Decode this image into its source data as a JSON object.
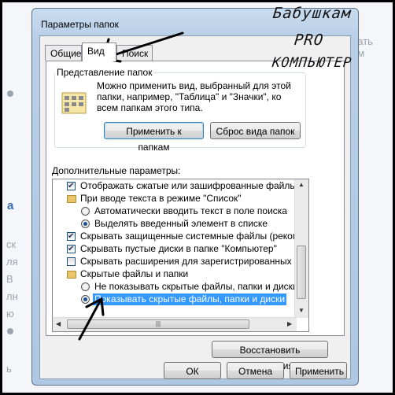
{
  "background": {
    "fragments": [
      "Бабушкам",
      "ть",
      "здать изм",
      "а",
      "ск",
      "ля",
      "В",
      "лн",
      "ю",
      "ь"
    ]
  },
  "window": {
    "title": "Параметры папок",
    "tabs": [
      "Общие",
      "Вид",
      "Поиск"
    ],
    "active_tab": "Вид",
    "folder_view": {
      "title": "Представление папок",
      "description": "Можно применить вид, выбранный для этой папки, например, \"Таблица\" и \"Значки\", ко всем папкам этого типа.",
      "apply_button": "Применить к папкам",
      "reset_button": "Сброс вида папок"
    },
    "advanced": {
      "label": "Дополнительные параметры:",
      "items": [
        {
          "kind": "checkbox",
          "checked": true,
          "indent": 0,
          "label": "Отображать сжатые или зашифрованные файлы NTF"
        },
        {
          "kind": "folder",
          "indent": 0,
          "label": "При вводе текста в режиме \"Список\""
        },
        {
          "kind": "radio",
          "checked": false,
          "indent": 1,
          "label": "Автоматически вводить текст в поле поиска"
        },
        {
          "kind": "radio",
          "checked": true,
          "indent": 1,
          "label": "Выделять введенный элемент в списке"
        },
        {
          "kind": "checkbox",
          "checked": true,
          "indent": 0,
          "label": "Скрывать защищенные системные файлы (рекомен"
        },
        {
          "kind": "checkbox",
          "checked": true,
          "indent": 0,
          "label": "Скрывать пустые диски в папке \"Компьютер\""
        },
        {
          "kind": "checkbox",
          "checked": false,
          "indent": 0,
          "label": "Скрывать расширения для зарегистрированных типо"
        },
        {
          "kind": "folder",
          "indent": 0,
          "label": "Скрытые файлы и папки"
        },
        {
          "kind": "radio",
          "checked": false,
          "indent": 1,
          "label": "Не показывать скрытые файлы, папки и диски"
        },
        {
          "kind": "radio",
          "checked": true,
          "indent": 1,
          "selected": true,
          "label": "Показывать скрытые файлы, папки и диски"
        }
      ],
      "restore_button": "Восстановить умолчания"
    },
    "buttons": {
      "ok": "ОК",
      "cancel": "Отмена",
      "apply": "Применить"
    }
  },
  "overlay": {
    "line1": "Бабушкам",
    "line2": "PRO",
    "line3": "КОМПЬЮТЕР"
  },
  "colors": {
    "selection": "#3399ff",
    "window_frame": "#b9cfe7"
  }
}
